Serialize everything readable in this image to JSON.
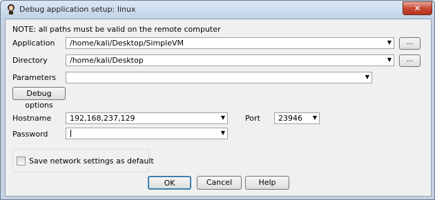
{
  "window": {
    "title": "Debug application setup: linux",
    "close_symbol": "✕"
  },
  "note": "NOTE: all paths must be valid on the remote computer",
  "fields": {
    "application": {
      "label": "Application",
      "value": "/home/kali/Desktop/SimpleVM"
    },
    "directory": {
      "label": "Directory",
      "value": "/home/kali/Desktop"
    },
    "parameters": {
      "label": "Parameters",
      "value": ""
    },
    "hostname": {
      "label": "Hostname",
      "value": "192,168,237,129"
    },
    "port": {
      "label": "Port",
      "value": "23946"
    },
    "password": {
      "label": "Password",
      "value": ""
    }
  },
  "browse_label": "...",
  "debug_options_label": "Debug options",
  "save_default": {
    "label": "Save network settings as default",
    "checked": false
  },
  "buttons": {
    "ok": "OK",
    "cancel": "Cancel",
    "help": "Help"
  },
  "icons": {
    "app": "ida-icon",
    "dropdown": "chevron-down-icon"
  }
}
